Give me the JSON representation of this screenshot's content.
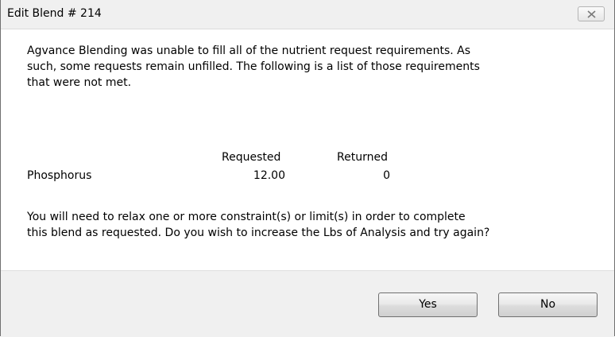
{
  "window": {
    "title": "Edit Blend # 214"
  },
  "message": {
    "lines": [
      "Agvance Blending was unable to fill all of the nutrient request requirements.  As",
      "such, some requests remain unfilled.  The following is a list of those requirements",
      "that were not met."
    ]
  },
  "table": {
    "headers": [
      "Requested",
      "Returned"
    ],
    "rows": [
      {
        "nutrient": "Phosphorus",
        "requested": "12.00",
        "returned": "0"
      }
    ]
  },
  "footer_message": {
    "lines": [
      "You will need to relax one or more constraint(s) or limit(s) in order to complete",
      "this blend as requested. Do you wish to increase the Lbs of Analysis and try again?"
    ]
  },
  "buttons": {
    "yes_label": "Yes",
    "no_label": "No"
  },
  "icons": {
    "close": "close-icon"
  }
}
